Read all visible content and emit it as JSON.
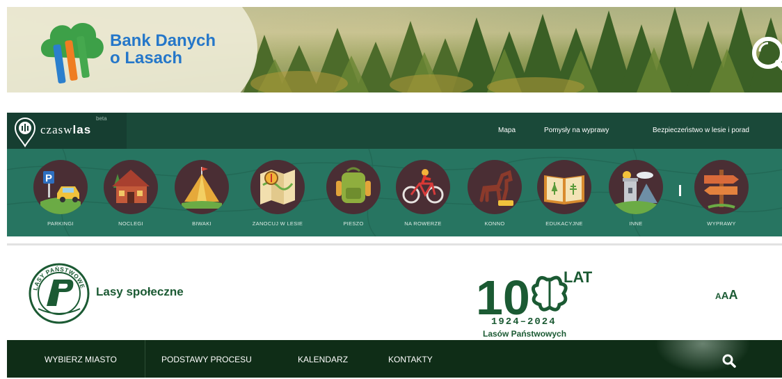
{
  "bank_danych": {
    "logo_line1": "Bank Danych",
    "logo_line2": "o Lasach",
    "search_icon": "search-icon"
  },
  "czas_w_las": {
    "brand_text_regular": "czasw",
    "brand_text_bold": "las",
    "brand_badge": "beta",
    "nav": [
      "Mapa",
      "Pomysły na wyprawy",
      "Bezpieczeństwo w lesie i porad"
    ],
    "categories": [
      {
        "label": "PARKINGI",
        "icon": "parking-icon"
      },
      {
        "label": "NOCLEGI",
        "icon": "cabin-icon"
      },
      {
        "label": "BIWAKI",
        "icon": "tent-icon"
      },
      {
        "label": "ZANOCUJ W LESIE",
        "icon": "map-icon"
      },
      {
        "label": "PIESZO",
        "icon": "backpack-icon"
      },
      {
        "label": "NA ROWERZE",
        "icon": "bicycle-icon"
      },
      {
        "label": "KONNO",
        "icon": "horse-icon"
      },
      {
        "label": "EDUKACYJNE",
        "icon": "book-icon"
      },
      {
        "label": "INNE",
        "icon": "tower-icon"
      },
      {
        "label": "WYPRAWY",
        "icon": "signpost-icon"
      }
    ]
  },
  "lasy_spoleczne": {
    "title": "Lasy społeczne",
    "seal_text": "LASY PAŃSTWOWE",
    "anniversary": {
      "big": "10",
      "lat": "LAT",
      "years": "1924–2024",
      "caption": "Lasów Państwowych"
    },
    "font_size_control": "AAA",
    "menu": [
      "WYBIERZ MIASTO",
      "PODSTAWY PROCESU",
      "KALENDARZ",
      "KONTAKTY"
    ]
  },
  "colors": {
    "bdl_blue": "#2577c9",
    "cwl_dark": "#1a4939",
    "cwl_strip": "#277561",
    "cwl_disc": "#4a2e34",
    "ls_green": "#1b5a33",
    "ls_bar": "#0f2d17"
  }
}
